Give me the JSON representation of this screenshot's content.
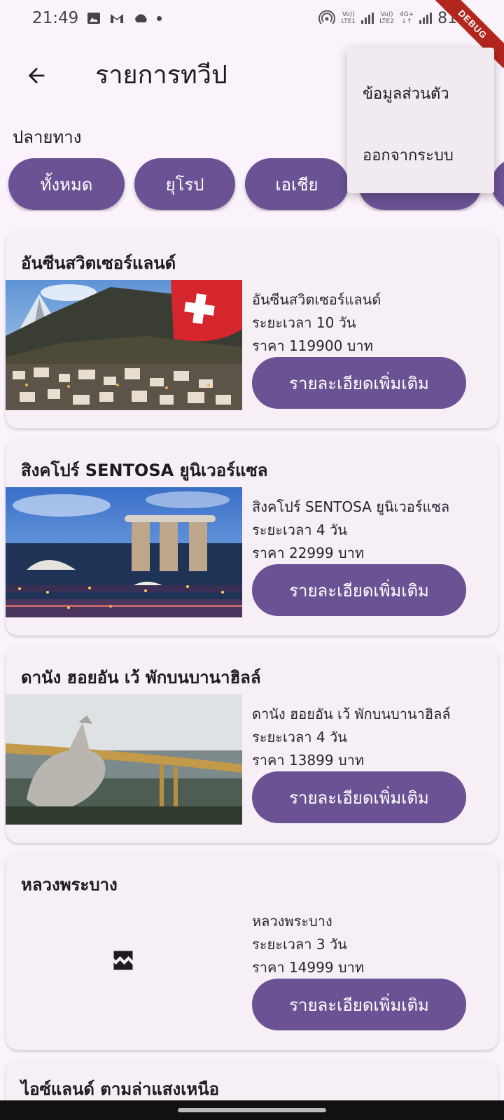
{
  "status_bar": {
    "time": "21:49",
    "battery": "81%",
    "sim1_label": "Vo))\nLTE1",
    "sim2_label": "Vo))\nLTE2",
    "network": "4G+",
    "debug_banner": "DEBUG"
  },
  "app_bar": {
    "title": "รายการทวีป"
  },
  "menu": {
    "items": [
      {
        "label": "ข้อมูลส่วนตัว"
      },
      {
        "label": "ออกจากระบบ"
      }
    ]
  },
  "filter": {
    "label": "ปลายทาง",
    "chips": [
      {
        "label": "ทั้งหมด"
      },
      {
        "label": "ยุโรป"
      },
      {
        "label": "เอเชีย"
      },
      {
        "label": ""
      }
    ]
  },
  "tours": [
    {
      "title": "อันซีนสวิตเซอร์แลนด์",
      "name": "อันซีนสวิตเซอร์แลนด์",
      "duration": "ระยะเวลา 10 วัน",
      "price": "ราคา 119900 บาท",
      "button": "รายละเอียดเพิ่มเติม",
      "image": "swiss-village-mountain"
    },
    {
      "title": "สิงคโปร์ SENTOSA ยูนิเวอร์แซล",
      "name": "สิงคโปร์ SENTOSA ยูนิเวอร์แซล",
      "duration": "ระยะเวลา 4 วัน",
      "price": "ราคา 22999 บาท",
      "button": "รายละเอียดเพิ่มเติม",
      "image": "singapore-marina-bay-night"
    },
    {
      "title": "ดานัง ฮอยอัน เว้ พักบนบานาฮิลล์",
      "name": "ดานัง ฮอยอัน เว้ พักบนบานาฮิลล์",
      "duration": "ระยะเวลา 4 วัน",
      "price": "ราคา 13899 บาท",
      "button": "รายละเอียดเพิ่มเติม",
      "image": "golden-bridge-hands"
    },
    {
      "title": "หลวงพระบาง",
      "name": "หลวงพระบาง",
      "duration": "ระยะเวลา 3 วัน",
      "price": "ราคา 14999 บาท",
      "button": "รายละเอียดเพิ่มเติม",
      "image": "broken-image-icon"
    },
    {
      "title": "ไอซ์แลนด์ ตามล่าแสงเหนือ"
    }
  ]
}
